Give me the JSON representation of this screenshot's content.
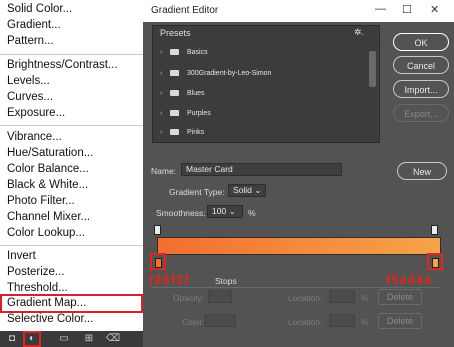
{
  "menu": {
    "items": [
      "Solid Color...",
      "Gradient...",
      "Pattern...",
      "Brightness/Contrast...",
      "Levels...",
      "Curves...",
      "Exposure...",
      "Vibrance...",
      "Hue/Saturation...",
      "Color Balance...",
      "Black & White...",
      "Photo Filter...",
      "Channel Mixer...",
      "Color Lookup...",
      "Invert",
      "Posterize...",
      "Threshold...",
      "Gradient Map...",
      "Selective Color..."
    ],
    "highlighted": "Gradient Map..."
  },
  "dialog": {
    "title": "Gradient Editor",
    "window_controls": {
      "minimize": "—",
      "maximize": "☐",
      "close": "✕"
    },
    "presets": {
      "label": "Presets",
      "gear": "✲.",
      "folders": [
        "Basics",
        "300Gradient-by-Leo-Simon",
        "Blues",
        "Purples",
        "Pinks"
      ]
    },
    "buttons": {
      "ok": "OK",
      "cancel": "Cancel",
      "import": "Import...",
      "export": "Export...",
      "new": "New"
    },
    "name_label": "Name:",
    "name_value": "Master Card",
    "gradient_type_label": "Gradient Type:",
    "gradient_type_value": "Solid",
    "smoothness_label": "Smoothness:",
    "smoothness_value": "100",
    "smoothness_unit": "%",
    "gradient_colors": {
      "start": "#f26f2f",
      "end": "#f5a44a"
    },
    "stops_label": "Stops",
    "opacity_label": "Opacity:",
    "location_label": "Location:",
    "percent": "%",
    "delete_label": "Delete",
    "color_label": "Color:",
    "annotations": {
      "left": "f26f2f",
      "right": "f5a44a"
    }
  },
  "accent": "#e0261f"
}
